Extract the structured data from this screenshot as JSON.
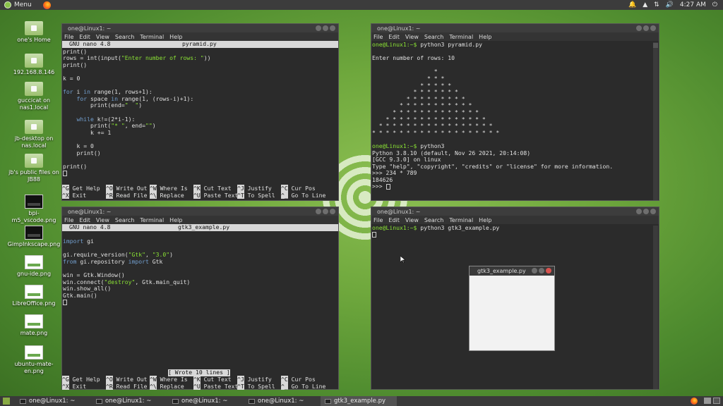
{
  "top_panel": {
    "menu_label": "Menu",
    "time": "4:27 AM"
  },
  "desktop_icons": [
    {
      "label": "one's Home",
      "icon": "home-folder-icon"
    },
    {
      "label": "192.168.8.146",
      "icon": "network-share-icon"
    },
    {
      "label": "guccicat on nas1.local",
      "icon": "network-share-icon"
    },
    {
      "label": "jb-desktop on nas.local",
      "icon": "network-share-icon"
    },
    {
      "label": "jb's public files on JB88",
      "icon": "network-share-icon"
    },
    {
      "label": "bpi-m5_vscode.png",
      "icon": "image-file-icon"
    },
    {
      "label": "GimpInkscape.png",
      "icon": "image-file-icon"
    },
    {
      "label": "gnu-ide.png",
      "icon": "image-file-icon"
    },
    {
      "label": "LibreOffice.png",
      "icon": "image-file-icon"
    },
    {
      "label": "mate.png",
      "icon": "image-file-icon"
    },
    {
      "label": "ubuntu-mate-en.png",
      "icon": "image-file-icon"
    }
  ],
  "terminal_menu": [
    "File",
    "Edit",
    "View",
    "Search",
    "Terminal",
    "Help"
  ],
  "win1": {
    "title": "one@Linux1: ~",
    "nano_version": "GNU nano 4.8",
    "file_name": "pyramid.py",
    "code": [
      "print()",
      "rows = int(input(\"Enter number of rows: \"))",
      "print()",
      "",
      "k = 0",
      "",
      "for i in range(1, rows+1):",
      "    for space in range(1, (rows-i)+1):",
      "        print(end=\"  \")",
      "",
      "    while k!=(2*i-1):",
      "        print(\"* \", end=\"\")",
      "        k += 1",
      "",
      "    k = 0",
      "    print()",
      "",
      "print()"
    ]
  },
  "win2": {
    "title": "one@Linux1: ~",
    "prompt": "one@Linux1:~$",
    "cmd1": " python3 pyramid.py",
    "lines": [
      "",
      "Enter number of rows: 10",
      "",
      "                  *",
      "                * * *",
      "              * * * * *",
      "            * * * * * * *",
      "          * * * * * * * * *",
      "        * * * * * * * * * * *",
      "      * * * * * * * * * * * * *",
      "    * * * * * * * * * * * * * * *",
      "  * * * * * * * * * * * * * * * * *",
      "* * * * * * * * * * * * * * * * * * *",
      ""
    ],
    "cmd2": " python3",
    "py_lines": [
      "Python 3.8.10 (default, Nov 26 2021, 20:14:08)",
      "[GCC 9.3.0] on linux",
      "Type \"help\", \"copyright\", \"credits\" or \"license\" for more information.",
      ">>> 234 * 789",
      "184626"
    ],
    "py_prompt": ">>> "
  },
  "win3": {
    "title": "one@Linux1: ~",
    "nano_version": "GNU nano 4.8",
    "file_name": "gtk3_example.py",
    "code": [
      "",
      "import gi",
      "",
      "gi.require_version(\"Gtk\", \"3.0\")",
      "from gi.repository import Gtk",
      "",
      "win = Gtk.Window()",
      "win.connect(\"destroy\", Gtk.main_quit)",
      "win.show_all()",
      "Gtk.main()"
    ],
    "status_message": "[ Wrote 10 lines ]"
  },
  "win4": {
    "title": "one@Linux1: ~",
    "prompt": "one@Linux1:~$",
    "cmd": " python3 gtk3_example.py"
  },
  "gtk_window": {
    "title": "gtk3_example.py"
  },
  "nano_shortcuts": {
    "row1": [
      [
        "^G",
        " Get Help"
      ],
      [
        "^O",
        " Write Out"
      ],
      [
        "^W",
        " Where Is"
      ],
      [
        "^K",
        " Cut Text"
      ],
      [
        "^J",
        " Justify"
      ],
      [
        "^C",
        " Cur Pos"
      ]
    ],
    "row2": [
      [
        "^X",
        " Exit"
      ],
      [
        "^R",
        " Read File"
      ],
      [
        "^\\",
        " Replace"
      ],
      [
        "^U",
        " Paste Text"
      ],
      [
        "^T",
        " To Spell"
      ],
      [
        "^_",
        " Go To Line"
      ]
    ]
  },
  "taskbar": [
    {
      "label": "one@Linux1: ~",
      "active": false
    },
    {
      "label": "one@Linux1: ~",
      "active": false
    },
    {
      "label": "one@Linux1: ~",
      "active": false
    },
    {
      "label": "one@Linux1: ~",
      "active": false
    },
    {
      "label": "gtk3_example.py",
      "active": true
    }
  ]
}
